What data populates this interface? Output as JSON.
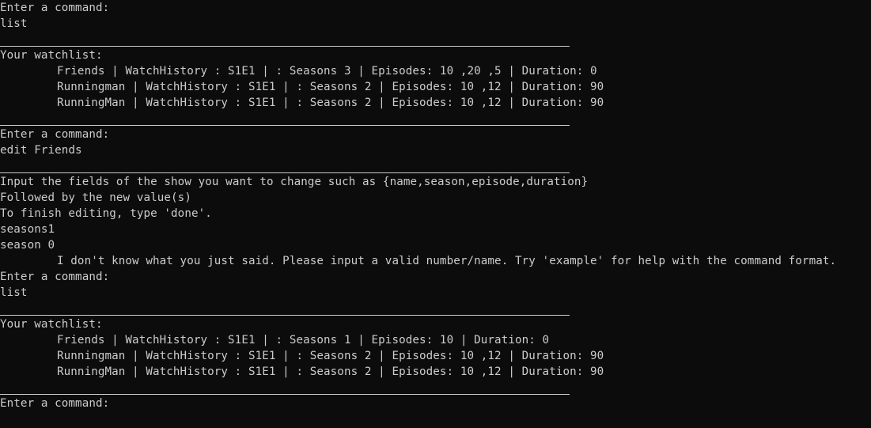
{
  "terminal": {
    "lines": [
      "Enter a command:",
      "list",
      "Your watchlist:",
      "Friends | WatchHistory : S1E1 | : Seasons 3 | Episodes: 10 ,20 ,5 | Duration: 0",
      "Runningman | WatchHistory : S1E1 | : Seasons 2 | Episodes: 10 ,12 | Duration: 90",
      "RunningMan | WatchHistory : S1E1 | : Seasons 2 | Episodes: 10 ,12 | Duration: 90",
      "Enter a command:",
      "edit Friends",
      "Input the fields of the show you want to change such as {name,season,episode,duration}",
      "Followed by the new value(s)",
      "To finish editing, type 'done'.",
      "seasons1",
      "season 0",
      "I don't know what you just said. Please input a valid number/name. Try 'example' for help with the command format.",
      "Enter a command:",
      "list",
      "Your watchlist:",
      "Friends | WatchHistory : S1E1 | : Seasons 1 | Episodes: 10 | Duration: 0",
      "Runningman | WatchHistory : S1E1 | : Seasons 2 | Episodes: 10 ,12 | Duration: 90",
      "RunningMan | WatchHistory : S1E1 | : Seasons 2 | Episodes: 10 ,12 | Duration: 90",
      "Enter a command:"
    ]
  }
}
